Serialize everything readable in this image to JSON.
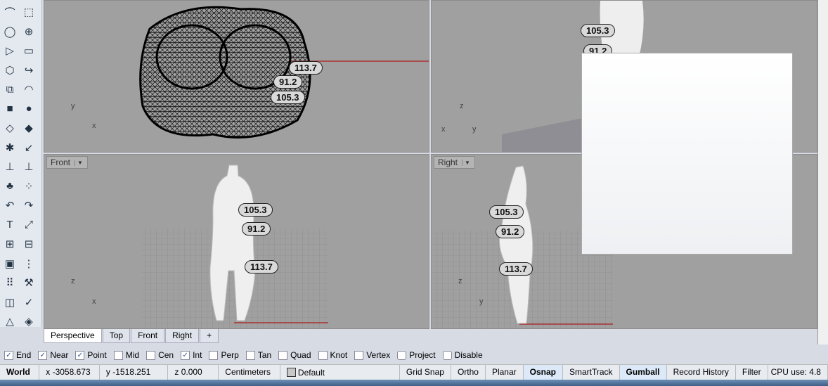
{
  "viewports": {
    "perspective": {
      "label": "Perspective",
      "dims": [
        "113.7",
        "91.2",
        "105.3"
      ],
      "axes": [
        "y",
        "x"
      ]
    },
    "top": {
      "label": "Top",
      "dims": [
        "105.3",
        "91.2"
      ],
      "axes": [
        "z",
        "x",
        "y"
      ]
    },
    "front": {
      "label": "Front",
      "dims": [
        "105.3",
        "91.2",
        "113.7"
      ],
      "axes": [
        "z",
        "x"
      ]
    },
    "right": {
      "label": "Right",
      "dims": [
        "105.3",
        "91.2",
        "113.7"
      ],
      "axes": [
        "z",
        "y"
      ]
    }
  },
  "tabs": [
    "Perspective",
    "Top",
    "Front",
    "Right",
    "+"
  ],
  "osnap": [
    {
      "label": "End",
      "checked": true
    },
    {
      "label": "Near",
      "checked": true
    },
    {
      "label": "Point",
      "checked": true
    },
    {
      "label": "Mid",
      "checked": false
    },
    {
      "label": "Cen",
      "checked": false
    },
    {
      "label": "Int",
      "checked": true
    },
    {
      "label": "Perp",
      "checked": false
    },
    {
      "label": "Tan",
      "checked": false
    },
    {
      "label": "Quad",
      "checked": false
    },
    {
      "label": "Knot",
      "checked": false
    },
    {
      "label": "Vertex",
      "checked": false
    },
    {
      "label": "Project",
      "checked": false
    },
    {
      "label": "Disable",
      "checked": false
    }
  ],
  "status": {
    "cplane": "World",
    "x": "x -3058.673",
    "y": "y -1518.251",
    "z": "z 0.000",
    "units": "Centimeters",
    "layer": "Default",
    "toggles": [
      "Grid Snap",
      "Ortho",
      "Planar",
      "Osnap",
      "SmartTrack",
      "Gumball",
      "Record History",
      "Filter"
    ],
    "cpu": "CPU use: 4.8"
  }
}
